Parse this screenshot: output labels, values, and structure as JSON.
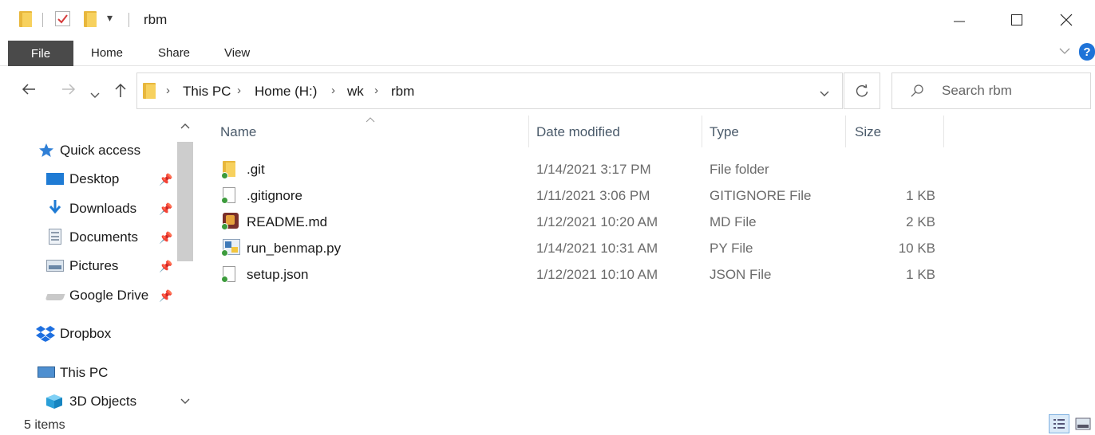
{
  "window": {
    "title": "rbm",
    "qat_dropdown": "▾"
  },
  "ribbon": {
    "tabs": [
      "File",
      "Home",
      "Share",
      "View"
    ]
  },
  "address": {
    "breadcrumbs": [
      "This PC",
      "Home (H:)",
      "wk",
      "rbm"
    ],
    "search_placeholder": "Search rbm"
  },
  "nav": {
    "items": [
      {
        "label": "Quick access",
        "icon": "star-icon"
      },
      {
        "label": "Desktop",
        "icon": "desktop-icon",
        "pinned": true
      },
      {
        "label": "Downloads",
        "icon": "download-arrow-icon",
        "pinned": true
      },
      {
        "label": "Documents",
        "icon": "documents-icon",
        "pinned": true
      },
      {
        "label": "Pictures",
        "icon": "pictures-icon",
        "pinned": true
      },
      {
        "label": "Google Drive",
        "icon": "drive-icon",
        "pinned": true
      },
      {
        "label": "Dropbox",
        "icon": "dropbox-icon"
      },
      {
        "label": "This PC",
        "icon": "computer-icon"
      },
      {
        "label": "3D Objects",
        "icon": "cube-icon"
      }
    ]
  },
  "columns": {
    "name": "Name",
    "date": "Date modified",
    "type": "Type",
    "size": "Size"
  },
  "files": [
    {
      "name": ".git",
      "date": "1/14/2021 3:17 PM",
      "type": "File folder",
      "size": "",
      "icon": "folder-icon"
    },
    {
      "name": ".gitignore",
      "date": "1/11/2021 3:06 PM",
      "type": "GITIGNORE File",
      "size": "1 KB",
      "icon": "file-icon"
    },
    {
      "name": "README.md",
      "date": "1/12/2021 10:20 AM",
      "type": "MD File",
      "size": "2 KB",
      "icon": "markdown-file-icon"
    },
    {
      "name": "run_benmap.py",
      "date": "1/14/2021 10:31 AM",
      "type": "PY File",
      "size": "10 KB",
      "icon": "python-file-icon"
    },
    {
      "name": "setup.json",
      "date": "1/12/2021 10:10 AM",
      "type": "JSON File",
      "size": "1 KB",
      "icon": "file-icon"
    }
  ],
  "status": {
    "item_count": "5 items"
  },
  "colors": {
    "file_tab_bg": "#4a4a4a",
    "folder_yellow": "#f7d15e",
    "sync_green": "#3c9b3c",
    "help_blue": "#1e73d8"
  }
}
